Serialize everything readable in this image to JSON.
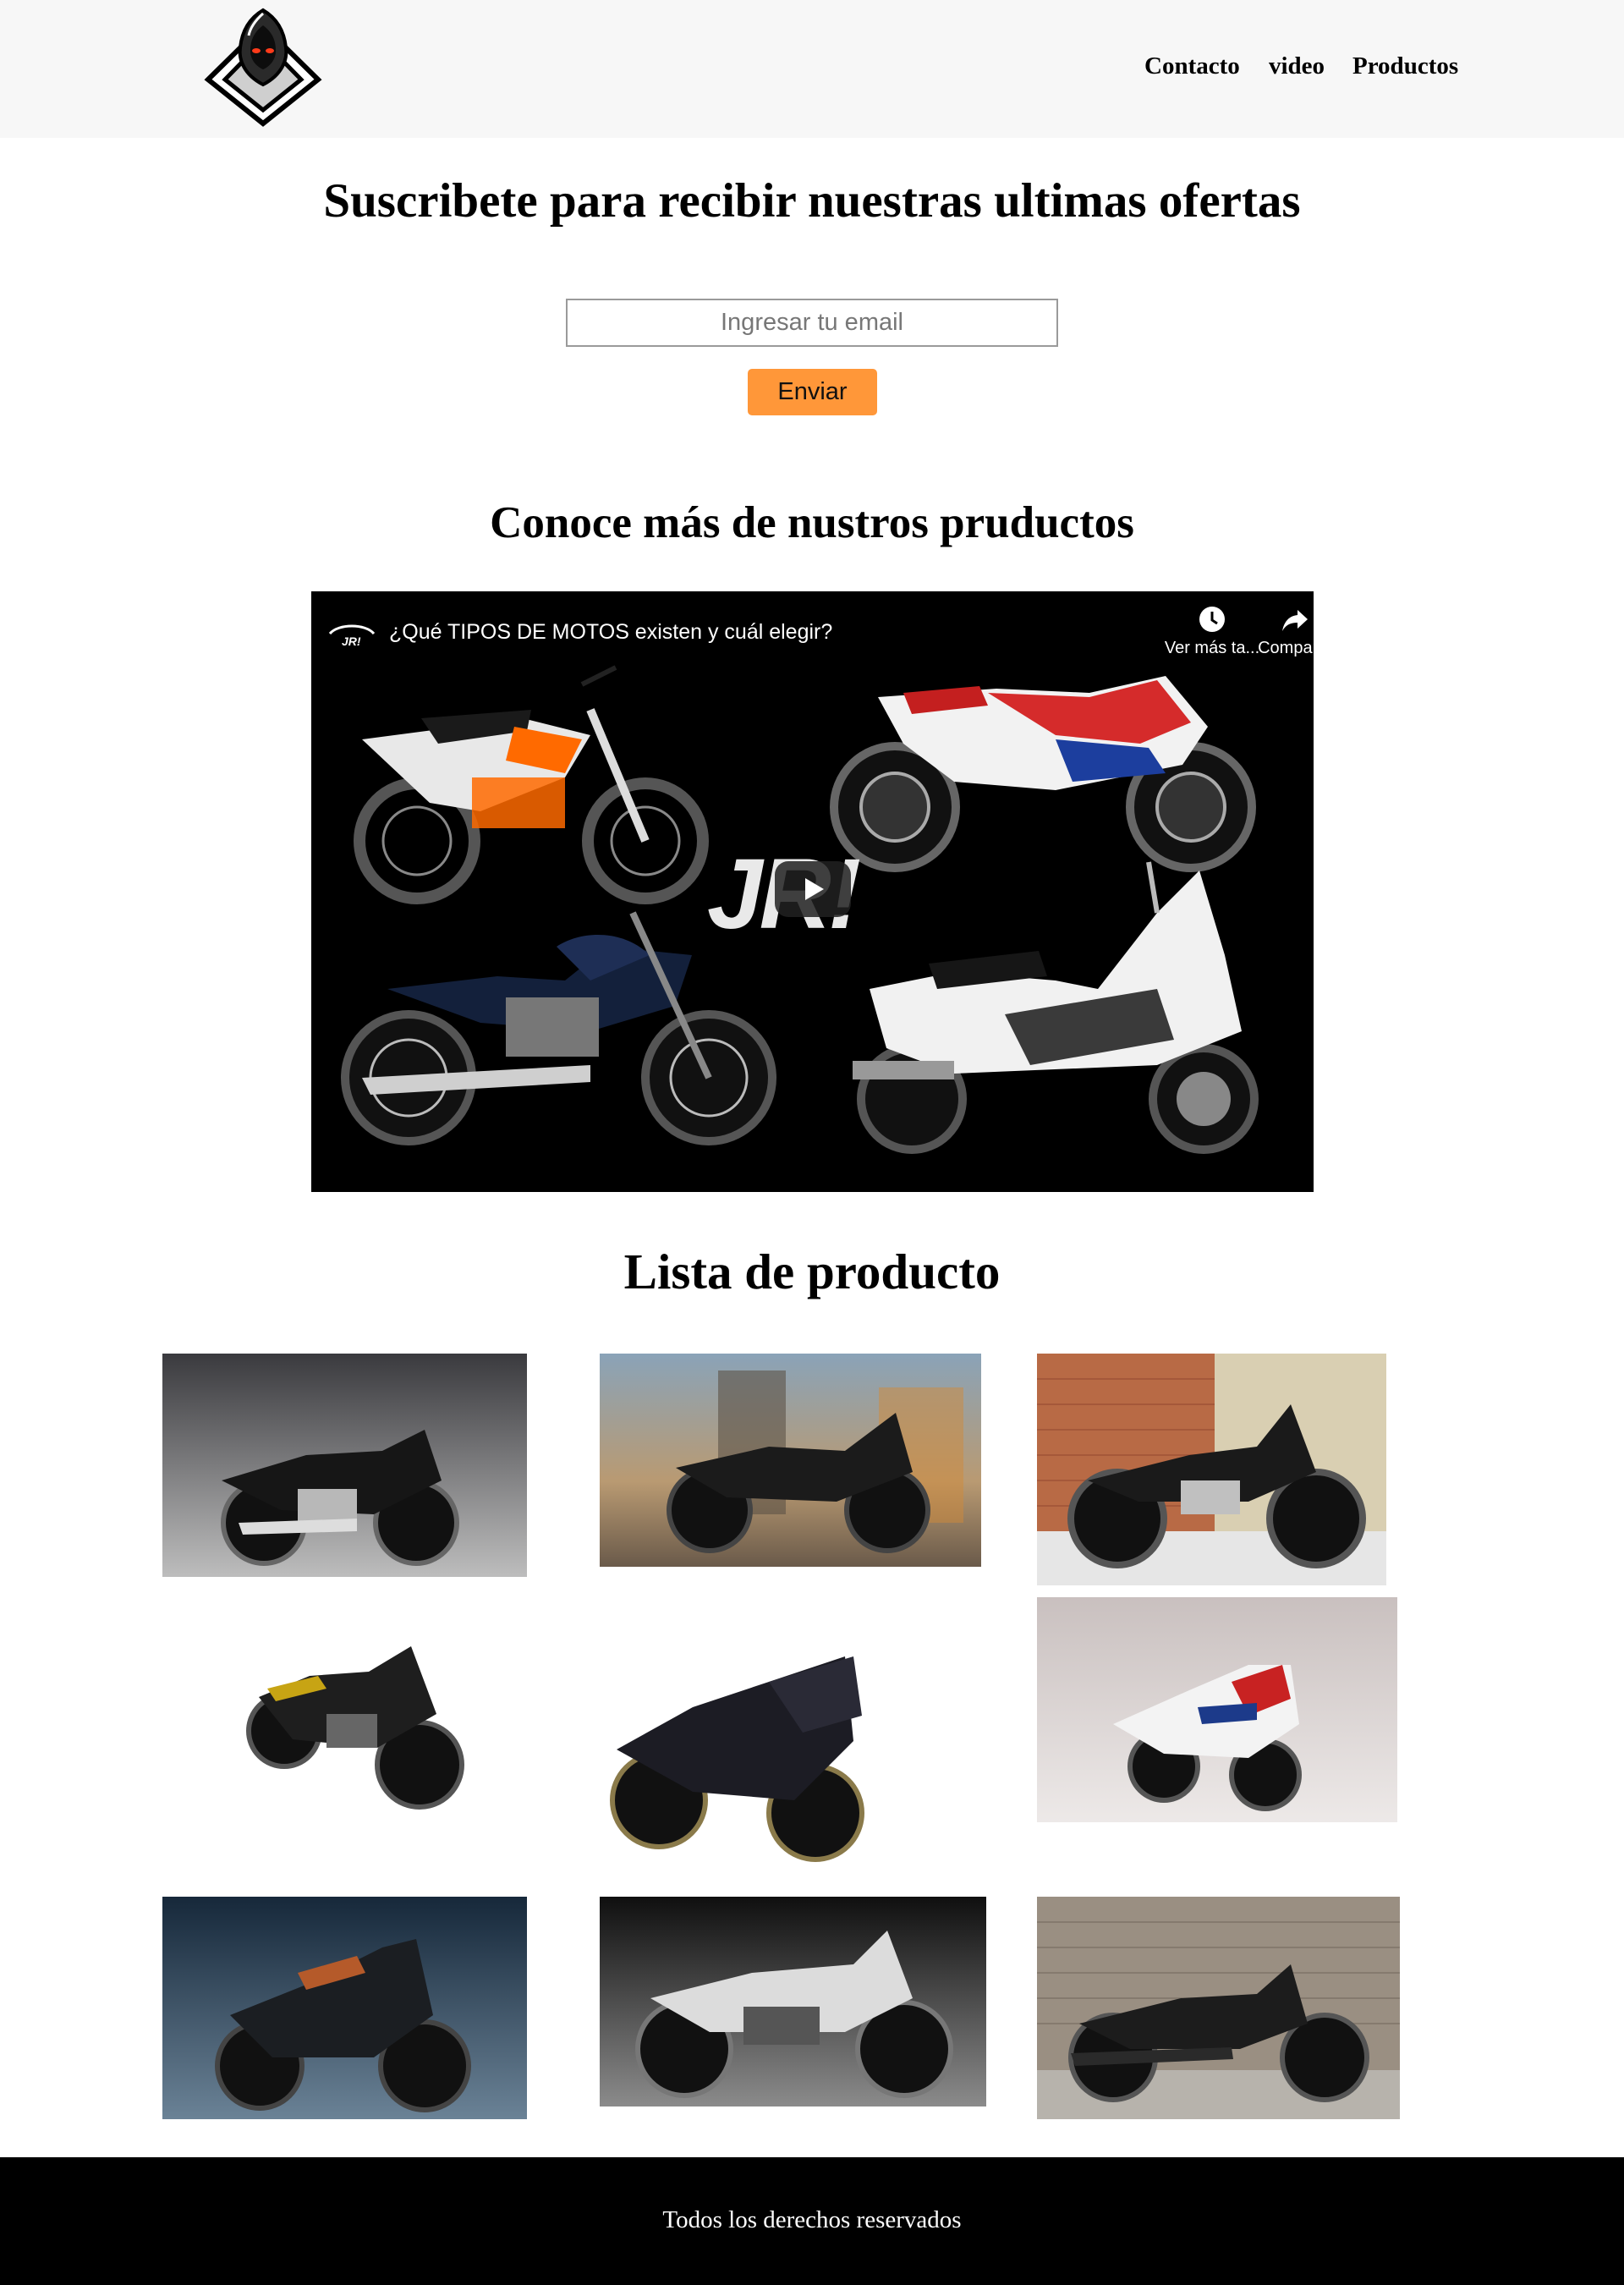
{
  "header": {
    "nav": [
      "Contacto",
      "video",
      "Productos"
    ]
  },
  "subscribe": {
    "title": "Suscribete para recibir nuestras ultimas ofertas",
    "email_placeholder": "Ingresar tu email",
    "send_label": "Enviar"
  },
  "video_section": {
    "title": "Conoce más de nustros pruductos",
    "video_title": "¿Qué TIPOS DE MOTOS existen y cuál elegir?",
    "watch_later": "Ver más ta...",
    "share": "Compartir",
    "watermark": "JR!"
  },
  "products": {
    "title": "Lista de producto",
    "items": [
      "motorcycle-1",
      "motorcycle-2",
      "motorcycle-3",
      "motorcycle-4",
      "motorcycle-5",
      "motorcycle-6",
      "motorcycle-7",
      "motorcycle-8",
      "motorcycle-9"
    ]
  },
  "footer": {
    "text": "Todos los derechos reservados"
  }
}
